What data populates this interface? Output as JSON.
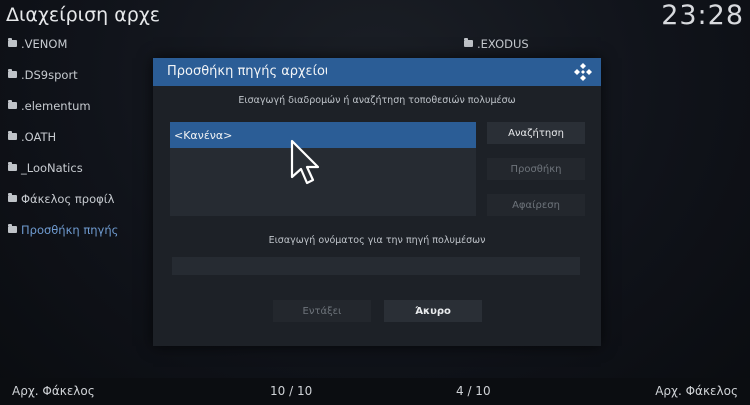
{
  "window": {
    "title": "Διαχείριση αρχείων",
    "clock": "23:28"
  },
  "left_pane": {
    "items": [
      {
        "label": ".VENOM"
      },
      {
        "label": ".DS9sport"
      },
      {
        "label": ".elementum"
      },
      {
        "label": ".OATH"
      },
      {
        "label": "_LooNatics"
      },
      {
        "label": "Φάκελος προφίλ"
      },
      {
        "label": "Προσθήκη πηγής"
      }
    ]
  },
  "right_pane": {
    "items": [
      {
        "label": ".EXODUS"
      }
    ]
  },
  "footer": {
    "left_label": "Αρχ. Φάκελος",
    "left_count": "10 / 10",
    "right_count": "4 / 10",
    "right_label": "Αρχ. Φάκελος"
  },
  "dialog": {
    "title": "Προσθήκη πηγής αρχείου",
    "subtitle": "Εισαγωγή διαδρομών ή αναζήτηση τοποθεσιών πολυμέσω",
    "list_selected": "<Κανένα>",
    "search_button": "Αναζήτηση",
    "add_button": "Προσθήκη",
    "remove_button": "Αφαίρεση",
    "name_label": "Εισαγωγή ονόματος για την πηγή πολυμέσων",
    "name_value": "",
    "ok_button": "Εντάξει",
    "cancel_button": "Άκυρο"
  },
  "colors": {
    "accent": "#2b5d96",
    "active_item": "#6f9bd0"
  }
}
